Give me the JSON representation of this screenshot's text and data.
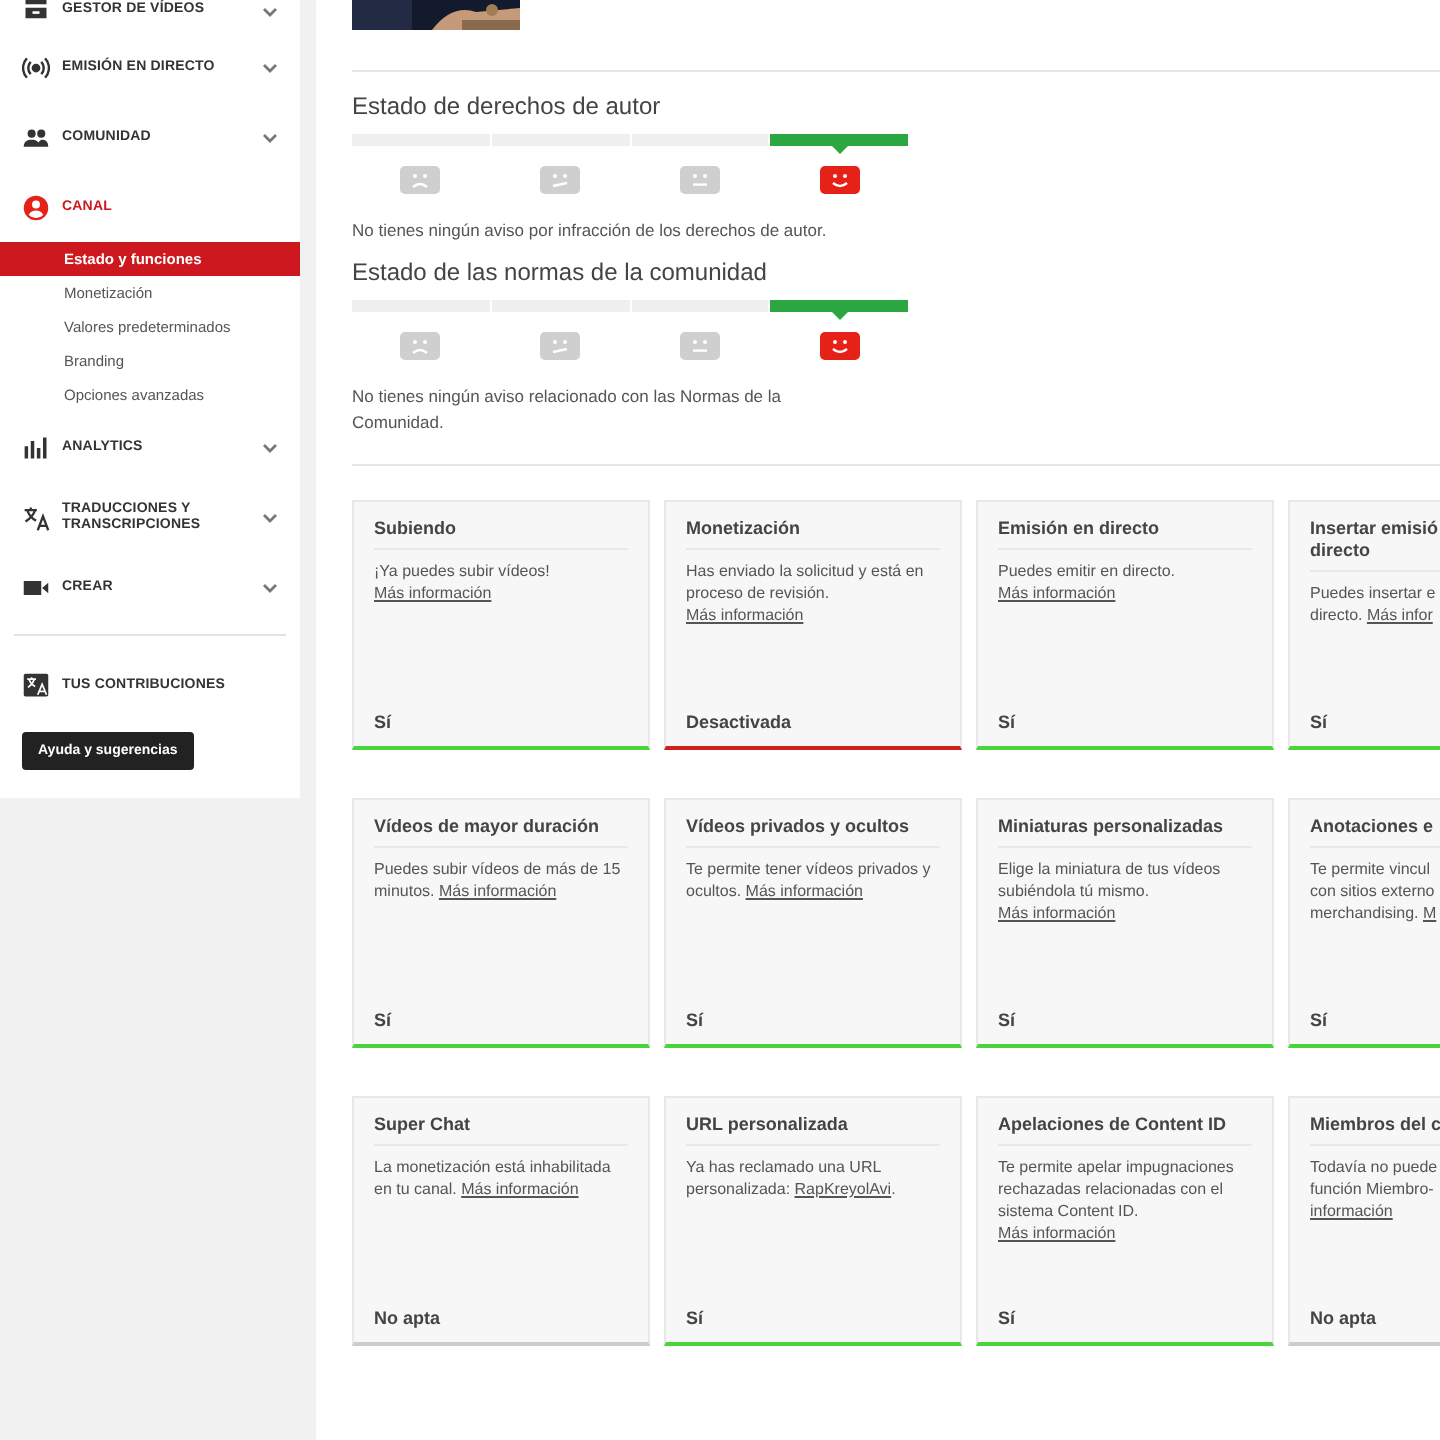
{
  "sidebar": {
    "items": [
      {
        "label": "GESTOR DE VÍDEOS",
        "selected": false,
        "expanded": false
      },
      {
        "label": "EMISIÓN EN DIRECTO",
        "selected": false,
        "expanded": false
      },
      {
        "label": "COMUNIDAD",
        "selected": false,
        "expanded": false
      },
      {
        "label": "CANAL",
        "selected": true,
        "expanded": true,
        "children": [
          {
            "label": "Estado y funciones",
            "selected": true
          },
          {
            "label": "Monetización",
            "selected": false
          },
          {
            "label": "Valores predeterminados",
            "selected": false
          },
          {
            "label": "Branding",
            "selected": false
          },
          {
            "label": "Opciones avanzadas",
            "selected": false
          }
        ]
      },
      {
        "label": "ANALYTICS",
        "selected": false,
        "expanded": false
      },
      {
        "label": "TRADUCCIONES Y TRANSCRIPCIONES",
        "selected": false,
        "expanded": false
      },
      {
        "label": "CREAR",
        "selected": false,
        "expanded": false
      }
    ],
    "footer_item": "TUS CONTRIBUCIONES",
    "help_button": "Ayuda y sugerencias"
  },
  "statuses": [
    {
      "title": "Estado de derechos de autor",
      "segments": [
        {
          "kind": "sad",
          "selected": false
        },
        {
          "kind": "meh",
          "selected": false
        },
        {
          "kind": "neutral",
          "selected": false
        },
        {
          "kind": "happy",
          "selected": true
        }
      ],
      "message": "No tienes ningún aviso por infracción de los derechos de autor."
    },
    {
      "title": "Estado de las normas de la comunidad",
      "segments": [
        {
          "kind": "sad",
          "selected": false
        },
        {
          "kind": "meh",
          "selected": false
        },
        {
          "kind": "neutral",
          "selected": false
        },
        {
          "kind": "happy",
          "selected": true
        }
      ],
      "message": "No tienes ningún aviso relacionado con las Normas de la Comunidad."
    }
  ],
  "features": [
    {
      "title": "Subiendo",
      "text": "¡Ya puedes subir vídeos! ",
      "link": "Más información",
      "status": "Sí",
      "kind": "enabled"
    },
    {
      "title": "Monetización",
      "text": "Has enviado la solicitud y está en proceso de revisión. ",
      "link": "Más información",
      "status": "Desactivada",
      "kind": "disabled"
    },
    {
      "title": "Emisión en directo",
      "text": "Puedes emitir en directo. ",
      "link": "Más información",
      "status": "Sí",
      "kind": "enabled"
    },
    {
      "title": "Insertar emisió\ndirecto",
      "text": "Puedes insertar e\ndirecto. ",
      "link": "Más infor",
      "status": "Sí",
      "kind": "enabled"
    },
    {
      "title": "Vídeos de mayor duración",
      "text": "Puedes subir vídeos de más de 15 minutos. ",
      "link": "Más información",
      "status": "Sí",
      "kind": "enabled"
    },
    {
      "title": "Vídeos privados y ocultos",
      "text": "Te permite tener vídeos privados y ocultos. ",
      "link": "Más información",
      "status": "Sí",
      "kind": "enabled"
    },
    {
      "title": "Miniaturas personalizadas",
      "text": "Elige la miniatura de tus vídeos subiéndola tú mismo. ",
      "link": "Más información",
      "status": "Sí",
      "kind": "enabled"
    },
    {
      "title": "Anotaciones e",
      "text": "Te permite vincul\ncon sitios externo\nmerchandising. ",
      "link": "M",
      "status": "Sí",
      "kind": "enabled"
    },
    {
      "title": "Super Chat",
      "text": "La monetización está inhabilitada en tu canal. ",
      "link": "Más información",
      "status": "No apta",
      "kind": "ineligible"
    },
    {
      "title": "URL personalizada",
      "text": "Ya has reclamado una URL personalizada: ",
      "link": "RapKreyolAvi",
      "after": ".",
      "status": "Sí",
      "kind": "enabled"
    },
    {
      "title": "Apelaciones de Content ID",
      "text": "Te permite apelar impugnaciones rechazadas relacionadas con el sistema Content ID. ",
      "link": "Más información",
      "status": "Sí",
      "kind": "enabled"
    },
    {
      "title": "Miembros del c",
      "text": "Todavía no puede\nfunción Miembro-\n",
      "link": "información",
      "status": "No apta",
      "kind": "ineligible"
    }
  ]
}
